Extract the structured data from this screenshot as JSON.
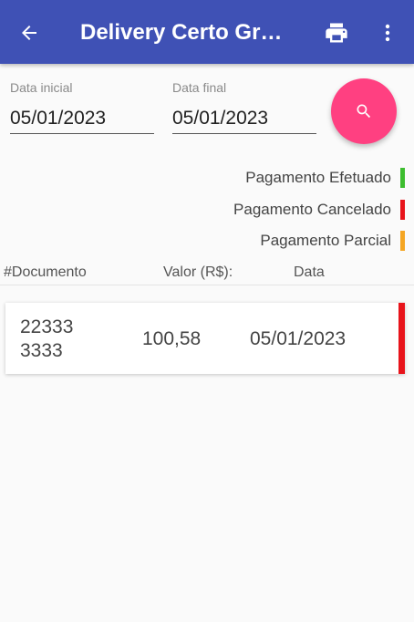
{
  "appbar": {
    "title": "Delivery Certo Grupo",
    "icons": {
      "back": "arrow-back-icon",
      "print": "print-icon",
      "more": "more-vertical-icon"
    }
  },
  "filters": {
    "start": {
      "label": "Data inicial",
      "value": "05/01/2023"
    },
    "end": {
      "label": "Data final",
      "value": "05/01/2023"
    },
    "search_icon": "search-icon",
    "search_color": "#ff4081"
  },
  "legend": [
    {
      "label": "Pagamento Efetuado",
      "color": "#3dbd2f"
    },
    {
      "label": "Pagamento Cancelado",
      "color": "#e8141b"
    },
    {
      "label": "Pagamento Parcial",
      "color": "#f5a623"
    }
  ],
  "table": {
    "headers": {
      "doc": "#Documento",
      "value": "Valor (R$):",
      "date": "Data"
    },
    "rows": [
      {
        "doc_line1": "22333",
        "doc_line2": "3333",
        "value": "100,58",
        "date": "05/01/2023",
        "status_color": "#e8141b"
      }
    ]
  },
  "colors": {
    "primary": "#3f51b5",
    "accent": "#ff4081"
  }
}
